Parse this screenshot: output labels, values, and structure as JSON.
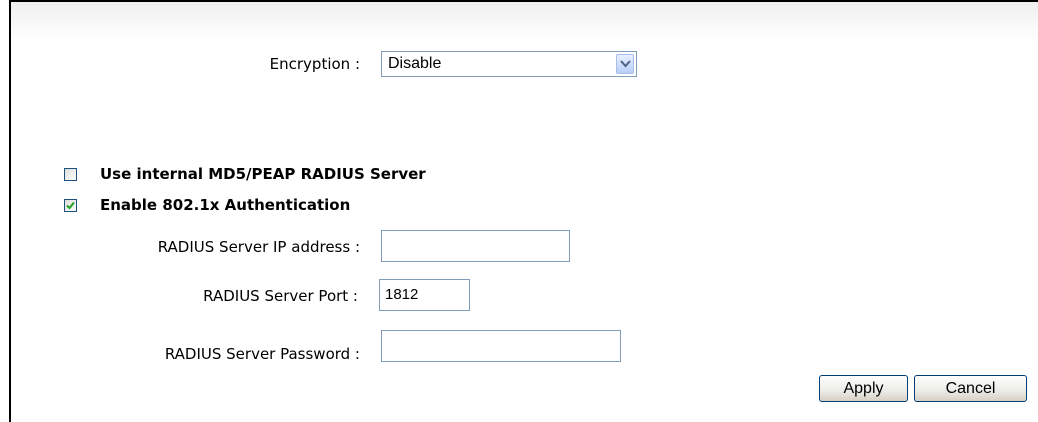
{
  "encryption": {
    "label": "Encryption :",
    "selected": "Disable"
  },
  "options": {
    "use_internal_radius": {
      "label": "Use internal MD5/PEAP RADIUS Server",
      "checked": false
    },
    "enable_8021x": {
      "label": "Enable 802.1x Authentication",
      "checked": true
    }
  },
  "radius": {
    "ip_label": "RADIUS Server IP address :",
    "ip_value": "",
    "port_label": "RADIUS Server Port :",
    "port_value": "1812",
    "password_label": "RADIUS Server Password :",
    "password_value": ""
  },
  "buttons": {
    "apply": "Apply",
    "cancel": "Cancel"
  }
}
